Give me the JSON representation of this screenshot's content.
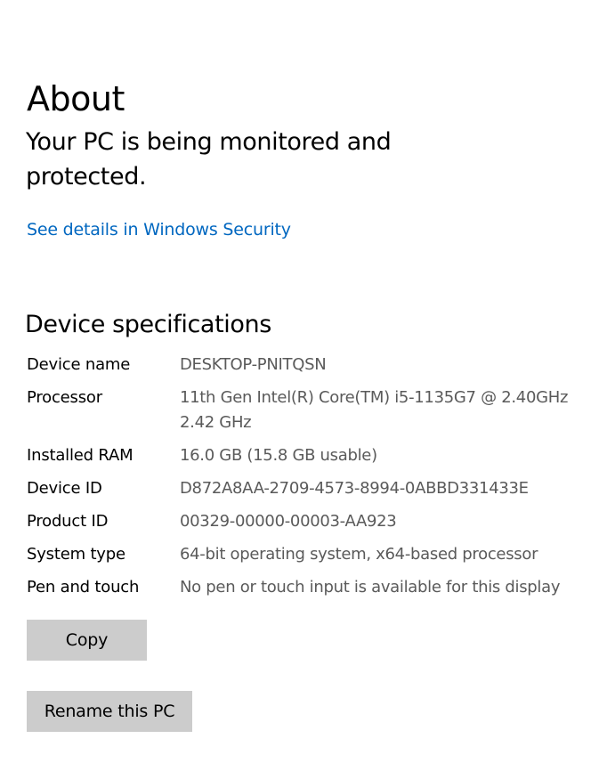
{
  "page": {
    "title": "About"
  },
  "security": {
    "status_text": "Your PC is being monitored and protected.",
    "link_label": "See details in Windows Security"
  },
  "device_specs": {
    "heading": "Device specifications",
    "rows": [
      {
        "label": "Device name",
        "value_lines": [
          "DESKTOP-PNITQSN"
        ]
      },
      {
        "label": "Processor",
        "value_lines": [
          "11th Gen Intel(R) Core(TM) i5-1135G7 @ 2.40GHz",
          "2.42 GHz"
        ]
      },
      {
        "label": "Installed RAM",
        "value_lines": [
          "16.0 GB (15.8 GB usable)"
        ]
      },
      {
        "label": "Device ID",
        "value_lines": [
          "D872A8AA-2709-4573-8994-0ABBD331433E"
        ]
      },
      {
        "label": "Product ID",
        "value_lines": [
          "00329-00000-00003-AA923"
        ]
      },
      {
        "label": "System type",
        "value_lines": [
          "64-bit operating system, x64-based processor"
        ]
      },
      {
        "label": "Pen and touch",
        "value_lines": [
          "No pen or touch input is available for this display"
        ]
      }
    ]
  },
  "buttons": {
    "copy_label": "Copy",
    "rename_label": "Rename this PC"
  },
  "colors": {
    "link": "#0067c0",
    "value_text": "#5a5a5a",
    "button_bg": "#cccccc"
  }
}
